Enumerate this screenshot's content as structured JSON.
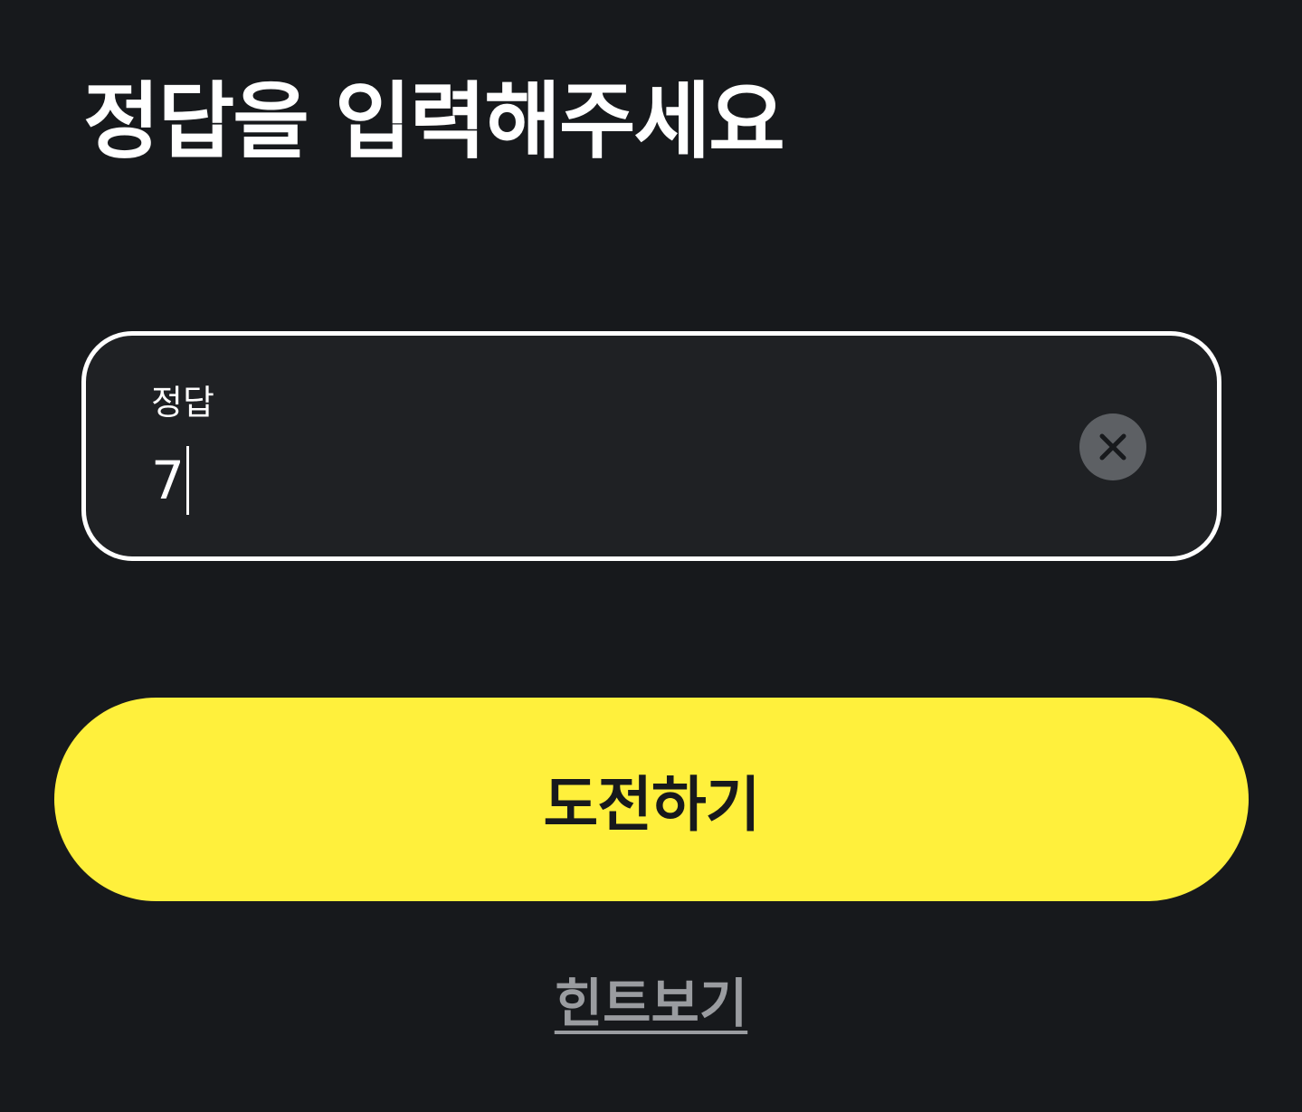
{
  "page": {
    "title": "정답을 입력해주세요"
  },
  "answer_field": {
    "label": "정답",
    "value": "7",
    "clear_icon": "close-icon"
  },
  "actions": {
    "submit_label": "도전하기",
    "hint_label": "힌트보기"
  },
  "colors": {
    "background": "#17191c",
    "field_background": "#1f2124",
    "accent": "#fff03c",
    "hint_text": "#9a9ca0"
  }
}
